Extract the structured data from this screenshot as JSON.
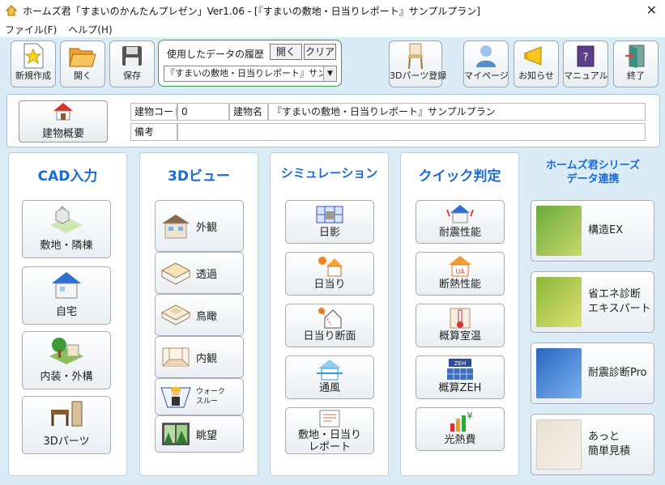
{
  "window": {
    "title": "ホームズ君「すまいのかんたんプレゼン」Ver1.06 - [『すまいの敷地・日当りレポート』サンプルプラン]",
    "close_glyph": "✕"
  },
  "menu": {
    "file": "ファイル(F)",
    "help": "ヘルプ(H)"
  },
  "toolbar": {
    "new": "新規作成",
    "open": "開く",
    "save": "保存",
    "history_label": "使用したデータの履歴",
    "history_open": "開く",
    "history_clear": "クリア",
    "history_value": "『すまいの敷地・日当りレポート』サンプ",
    "parts3d": "3Dパーツ登録",
    "mypage": "マイページ",
    "news": "お知らせ",
    "manual": "マニュアル",
    "exit": "終了"
  },
  "building": {
    "overview_button": "建物概要",
    "code_label": "建物コード",
    "code_value": "0",
    "name_label": "建物名",
    "name_value": "『すまいの敷地・日当りレポート』サンプルプラン",
    "note_label": "備考",
    "note_value": ""
  },
  "cad": {
    "title": "CAD入力",
    "items": [
      "敷地・隣棟",
      "自宅",
      "内装・外構",
      "3Dパーツ"
    ]
  },
  "view3d": {
    "title": "3Dビュー",
    "items": [
      "外観",
      "透過",
      "鳥瞰",
      "内観",
      "ウォーク\nスルー",
      "眺望"
    ]
  },
  "simulation": {
    "title": "シミュレーション",
    "items": [
      "日影",
      "日当り",
      "日当り断面",
      "通風",
      "敷地・日当り\nレポート"
    ]
  },
  "quick": {
    "title": "クイック判定",
    "items": [
      "耐震性能",
      "断熱性能",
      "概算室温",
      "概算ZEH",
      "光熱費"
    ]
  },
  "series": {
    "title": "ホームズ君シリーズ\nデータ連携",
    "items": [
      "構造EX",
      "省エネ診断\nエキスパート",
      "耐震診断Pro",
      "あっと\n簡単見積"
    ]
  },
  "colors": {
    "accent": "#1a6bd6",
    "background": "#dcecf6"
  }
}
